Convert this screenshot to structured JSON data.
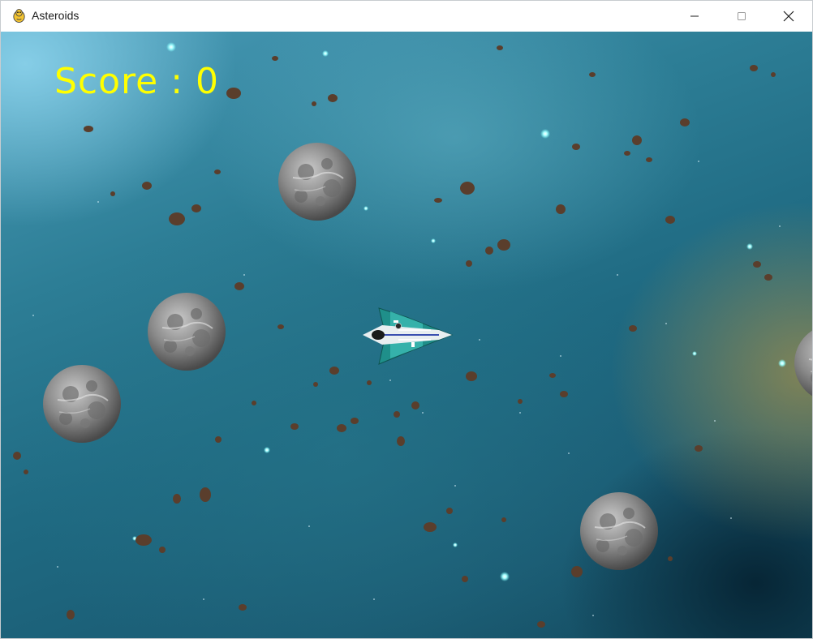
{
  "window": {
    "title": "Asteroids",
    "app_icon": "pygame-snake-icon",
    "controls": {
      "minimize_icon": "minimize-icon",
      "maximize_icon": "maximize-icon",
      "close_icon": "close-icon"
    }
  },
  "hud": {
    "score_text": "Score : 0"
  },
  "colors": {
    "score": "#ffff00",
    "space_dark": "#134a5e",
    "space_light": "#4a9cb8"
  }
}
